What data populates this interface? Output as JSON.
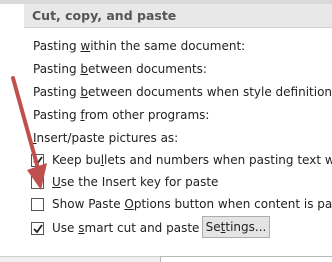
{
  "section": {
    "title": "Cut, copy, and paste"
  },
  "paste_rows": [
    {
      "pre": "Pasting ",
      "key": "w",
      "post": "ithin the same document:"
    },
    {
      "pre": "Pasting ",
      "key": "b",
      "post": "etween documents:"
    },
    {
      "pre": "Pasting ",
      "key": "b",
      "post": "etween documents when style definitions confl"
    },
    {
      "pre": "Pasting ",
      "key": "f",
      "post": "rom other programs:"
    },
    {
      "pre": "",
      "key": "I",
      "post": "nsert/paste pictures as:"
    }
  ],
  "checkboxes": [
    {
      "pre": "Keep bu",
      "key": "l",
      "post": "lets and numbers when pasting text with Kee",
      "checked": true
    },
    {
      "pre": "",
      "key": "U",
      "post": "se the Insert key for paste",
      "checked": false
    },
    {
      "pre": "Show Paste ",
      "key": "O",
      "post": "ptions button when content is pasted",
      "checked": false
    },
    {
      "pre": "Use ",
      "key": "s",
      "post": "mart cut and paste",
      "checked": true
    }
  ],
  "info_icon": "info-icon",
  "settings_button": {
    "pre": "Se",
    "key": "t",
    "post": "tings..."
  },
  "annotation": {
    "arrow_color": "#c0504d"
  }
}
